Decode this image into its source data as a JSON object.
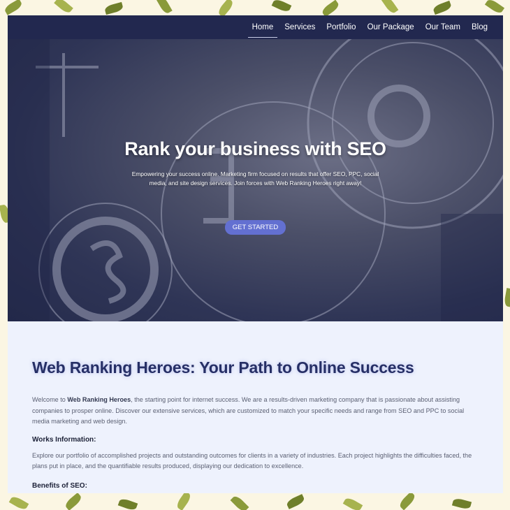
{
  "nav": {
    "items": [
      {
        "label": "Home",
        "active": true
      },
      {
        "label": "Services",
        "active": false
      },
      {
        "label": "Portfolio",
        "active": false
      },
      {
        "label": "Our Package",
        "active": false
      },
      {
        "label": "Our Team",
        "active": false
      },
      {
        "label": "Blog",
        "active": false
      }
    ]
  },
  "hero": {
    "title": "Rank your business with SEO",
    "subtitle": "Empowering your success online. Marketing firm focused on results that offer SEO, PPC, social media, and site design services. Join forces with Web Ranking Heroes right away!",
    "cta_label": "GET STARTED"
  },
  "main": {
    "heading": "Web Ranking Heroes: Your Path to Online Success",
    "intro_prefix": "Welcome to ",
    "intro_brand": "Web Ranking Heroes",
    "intro_rest": ", the starting point for internet success. We are a results-driven marketing company that is passionate about assisting companies to prosper online. Discover our extensive services, which are customized to match your specific needs and range from SEO and PPC to social media marketing and web design.",
    "works_heading": "Works Information:",
    "works_text": "Explore our portfolio of accomplished projects and outstanding outcomes for clients in a variety of industries. Each project highlights the difficulties faced, the plans put in place, and the quantifiable results produced, displaying our dedication to excellence.",
    "benefits_heading": "Benefits of SEO:"
  },
  "colors": {
    "nav_bg": "#22284f",
    "accent_button": "#6370d1",
    "heading": "#262f66",
    "content_bg": "#eef2fd",
    "leaf": "#8a9a3a"
  }
}
